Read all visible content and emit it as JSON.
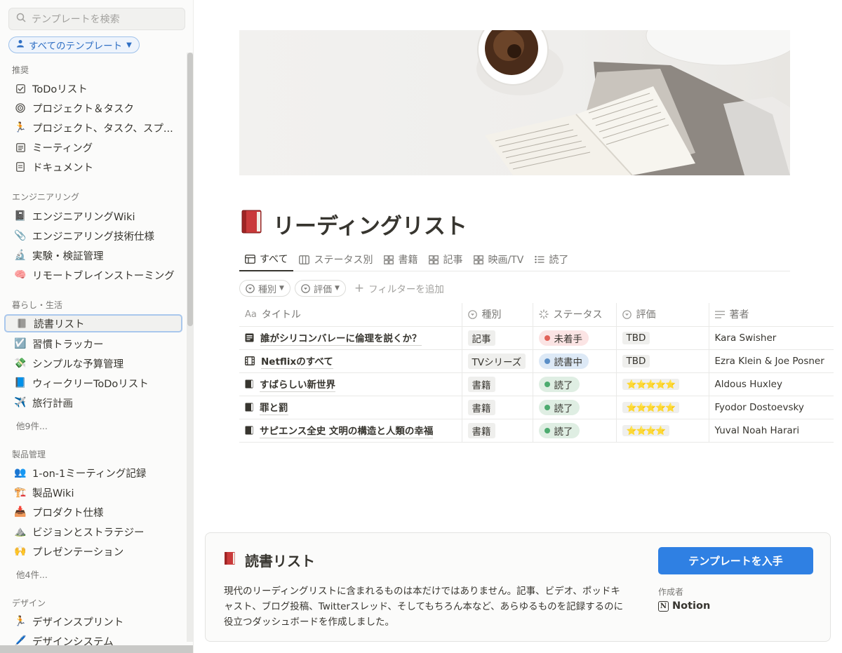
{
  "sidebar": {
    "search_placeholder": "テンプレートを検索",
    "filter_pill": "すべてのテンプレート",
    "sections": [
      {
        "title": "推奨",
        "items": [
          "ToDoリスト",
          "プロジェクト＆タスク",
          "プロジェクト、タスク、スプ...",
          "ミーティング",
          "ドキュメント"
        ]
      },
      {
        "title": "エンジニアリング",
        "items": [
          "エンジニアリングWiki",
          "エンジニアリング技術仕様",
          "実験・検証管理",
          "リモートブレインストーミング"
        ]
      },
      {
        "title": "暮らし・生活",
        "items": [
          "読書リスト",
          "習慣トラッカー",
          "シンプルな予算管理",
          "ウィークリーToDoリスト",
          "旅行計画"
        ],
        "more": "他9件..."
      },
      {
        "title": "製品管理",
        "items": [
          "1-on-1ミーティング記録",
          "製品Wiki",
          "プロダクト仕様",
          "ビジョンとストラテジー",
          "プレゼンテーション"
        ],
        "more": "他4件..."
      },
      {
        "title": "デザイン",
        "items": [
          "デザインスプリント",
          "デザインシステム"
        ]
      }
    ],
    "active_item": "読書リスト"
  },
  "page": {
    "title": "リーディングリスト",
    "title_icon": "book-red-icon",
    "tabs": [
      "すべて",
      "ステータス別",
      "書籍",
      "記事",
      "映画/TV",
      "読了"
    ],
    "active_tab": "すべて",
    "filters": [
      "種別",
      "評価"
    ],
    "add_filter": "フィルターを追加"
  },
  "table": {
    "columns": [
      "タイトル",
      "種別",
      "ステータス",
      "評価",
      "著者"
    ],
    "rows": [
      {
        "title": "誰がシリコンバレーに倫理を説くか？",
        "icon": "article-icon",
        "type": "記事",
        "status": "未着手",
        "status_color": "#e16259",
        "status_bg": "#fbe4e4",
        "rating": "TBD",
        "author": "Kara Swisher"
      },
      {
        "title": "Netflixのすべて",
        "icon": "film-icon",
        "type": "TVシリーズ",
        "status": "読書中",
        "status_color": "#5b8fc7",
        "status_bg": "#dde9f6",
        "rating": "TBD",
        "author": "Ezra Klein & Joe Posner"
      },
      {
        "title": "すばらしい新世界",
        "icon": "book-icon",
        "type": "書籍",
        "status": "読了",
        "status_color": "#4dab6f",
        "status_bg": "#dfeee3",
        "rating": "⭐⭐⭐⭐⭐",
        "author": "Aldous Huxley"
      },
      {
        "title": "罪と罰",
        "icon": "book-icon",
        "type": "書籍",
        "status": "読了",
        "status_color": "#4dab6f",
        "status_bg": "#dfeee3",
        "rating": "⭐⭐⭐⭐⭐",
        "author": "Fyodor Dostoevsky"
      },
      {
        "title": "サピエンス全史 文明の構造と人類の幸福",
        "icon": "book-icon",
        "type": "書籍",
        "status": "読了",
        "status_color": "#4dab6f",
        "status_bg": "#dfeee3",
        "rating": "⭐⭐⭐⭐",
        "author": "Yuval Noah Harari"
      }
    ]
  },
  "card": {
    "title": "読書リスト",
    "description": "現代のリーディングリストに含まれるものは本だけではありません。記事、ビデオ、ポッドキャスト、ブログ投稿、Twitterスレッド、そしてもちろん本など、あらゆるものを記録するのに役立つダッシュボードを作成しました。",
    "button": "テンプレートを入手",
    "author_label": "作成者",
    "author": "Notion",
    "author_logo": "N"
  },
  "colors": {
    "accent": "#2f80e3",
    "pill_border": "#9ec1ea"
  }
}
